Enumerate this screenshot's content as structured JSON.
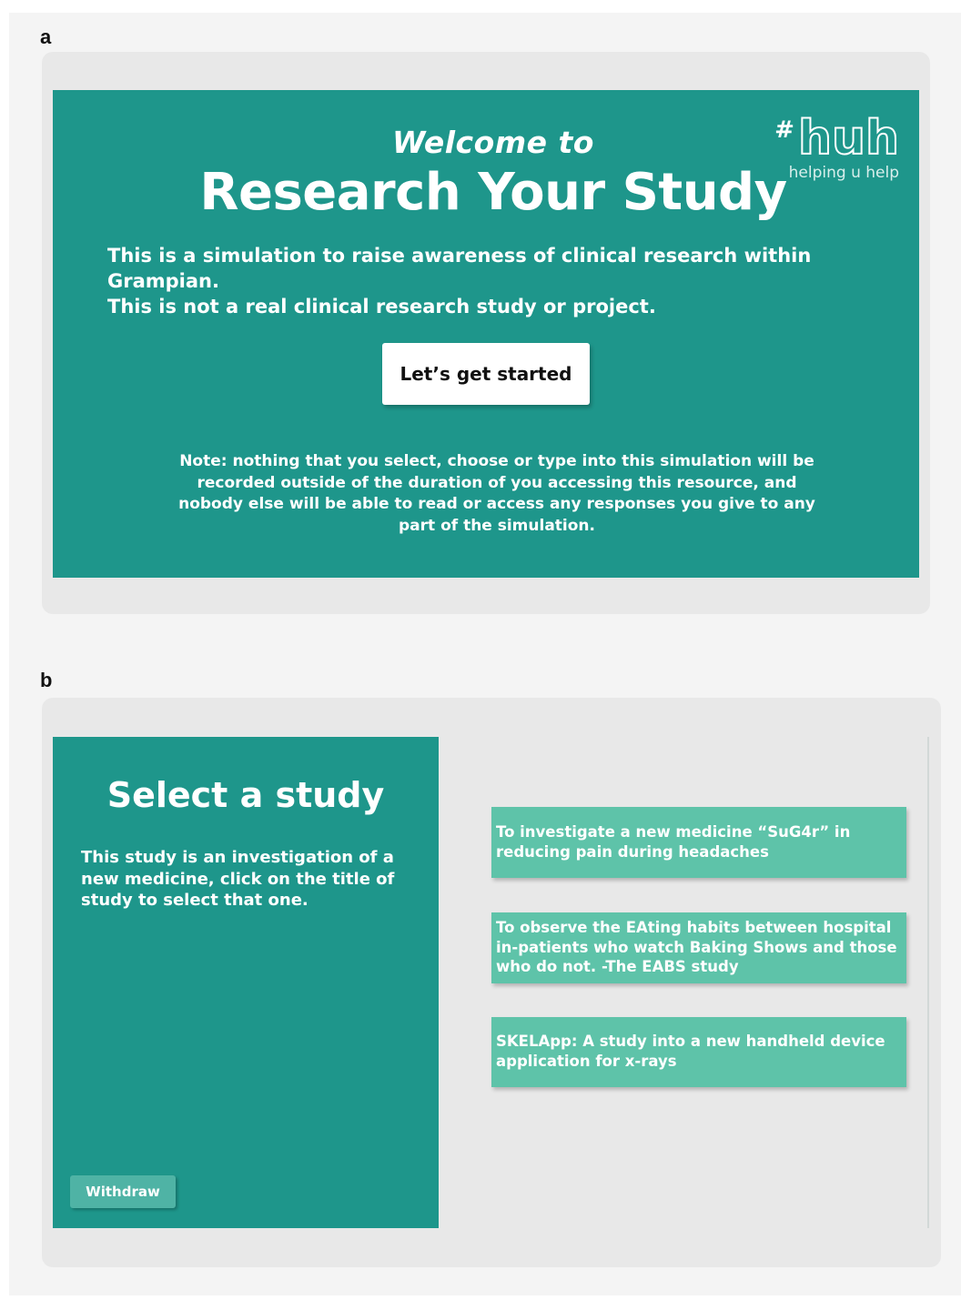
{
  "panels": {
    "a_label": "a",
    "b_label": "b"
  },
  "welcome": {
    "kicker": "Welcome to",
    "title": "Research Your Study",
    "logo": {
      "hash": "#",
      "main": "huh",
      "tagline": "helping u help"
    },
    "intro_line1": "This is a simulation to raise awareness of clinical research within Grampian.",
    "intro_line2": "This is not a real clinical research study or project.",
    "start_label": "Let’s get started",
    "note": "Note: nothing that you select, choose or type into this simulation will be recorded outside of the duration of you accessing this resource, and nobody else will be able to read or access any responses you give to any part of the simulation."
  },
  "select": {
    "title": "Select a study",
    "description": "This study is an investigation of a new medicine, click on the title of study to select that one.",
    "withdraw_label": "Withdraw",
    "studies": [
      {
        "label": "To investigate a new medicine “SuG4r” in reducing pain during headaches"
      },
      {
        "label": "To observe the EAting habits between hospital in-patients who watch Baking Shows and those who do not. -The EABS study"
      },
      {
        "label": "SKELApp: A study into a new handheld device application for x-rays"
      }
    ]
  },
  "colors": {
    "teal": "#1e968b",
    "option": "#5ec3a9",
    "withdraw": "#4fb3a5",
    "frame": "#e8e8e8"
  }
}
